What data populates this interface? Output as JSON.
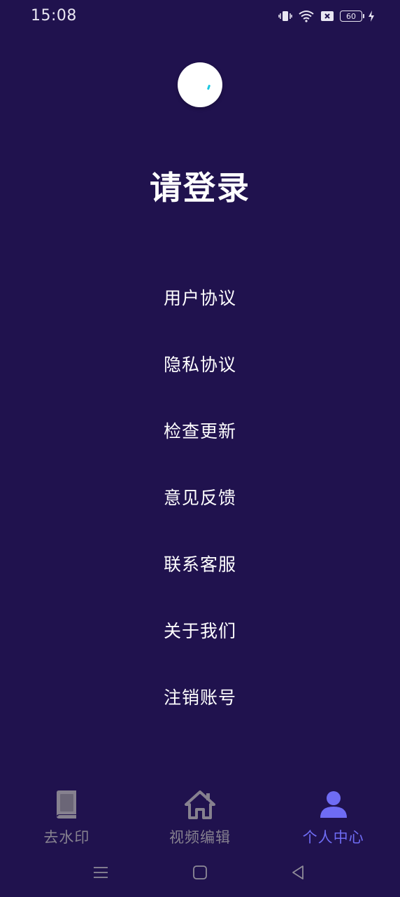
{
  "status_bar": {
    "time": "15:08",
    "battery_level": "60",
    "icons": [
      "vibrate-icon",
      "wifi-icon",
      "sim-off-icon",
      "battery-icon",
      "charging-icon"
    ]
  },
  "profile": {
    "login_prompt": "请登录"
  },
  "menu": {
    "items": [
      {
        "label": "用户协议"
      },
      {
        "label": "隐私协议"
      },
      {
        "label": "检查更新"
      },
      {
        "label": "意见反馈"
      },
      {
        "label": "联系客服"
      },
      {
        "label": "关于我们"
      },
      {
        "label": "注销账号"
      }
    ]
  },
  "tab_bar": {
    "tabs": [
      {
        "label": "去水印",
        "icon": "book-icon",
        "active": false
      },
      {
        "label": "视频编辑",
        "icon": "home-icon",
        "active": false
      },
      {
        "label": "个人中心",
        "icon": "person-icon",
        "active": true
      }
    ]
  },
  "colors": {
    "background": "#20124e",
    "tab_inactive": "#86818f",
    "tab_active": "#6f6cf4",
    "avatar_accent": "#19c7e0"
  }
}
